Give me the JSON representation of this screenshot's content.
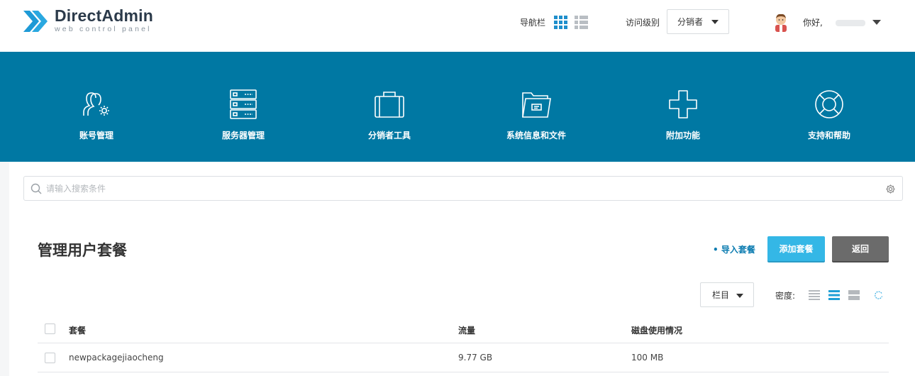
{
  "header": {
    "logo_title": "DirectAdmin",
    "logo_subtitle": "web control panel",
    "nav_label": "导航栏",
    "access_level_label": "访问级别",
    "access_level_value": "分销者",
    "greeting": "你好,"
  },
  "menu": [
    {
      "label": "账号管理",
      "icon": "user-gear-icon"
    },
    {
      "label": "服务器管理",
      "icon": "server-icon"
    },
    {
      "label": "分销者工具",
      "icon": "briefcase-icon"
    },
    {
      "label": "系统信息和文件",
      "icon": "folder-icon"
    },
    {
      "label": "附加功能",
      "icon": "plus-icon"
    },
    {
      "label": "支持和帮助",
      "icon": "lifebuoy-icon"
    }
  ],
  "search": {
    "placeholder": "请输入搜索条件"
  },
  "page": {
    "title": "管理用户套餐",
    "import_link": "• 导入套餐",
    "add_button": "添加套餐",
    "back_button": "返回",
    "columns_button": "栏目",
    "density_label": "密度:"
  },
  "table": {
    "headers": [
      "套餐",
      "流量",
      "磁盘使用情况"
    ],
    "rows": [
      {
        "package": "newpackagejiaocheng",
        "bandwidth": "9.77 GB",
        "disk": "100 MB"
      }
    ]
  },
  "colors": {
    "brand_band": "#0078a3",
    "accent": "#34b7e6",
    "logo": "#1e9ad6"
  }
}
